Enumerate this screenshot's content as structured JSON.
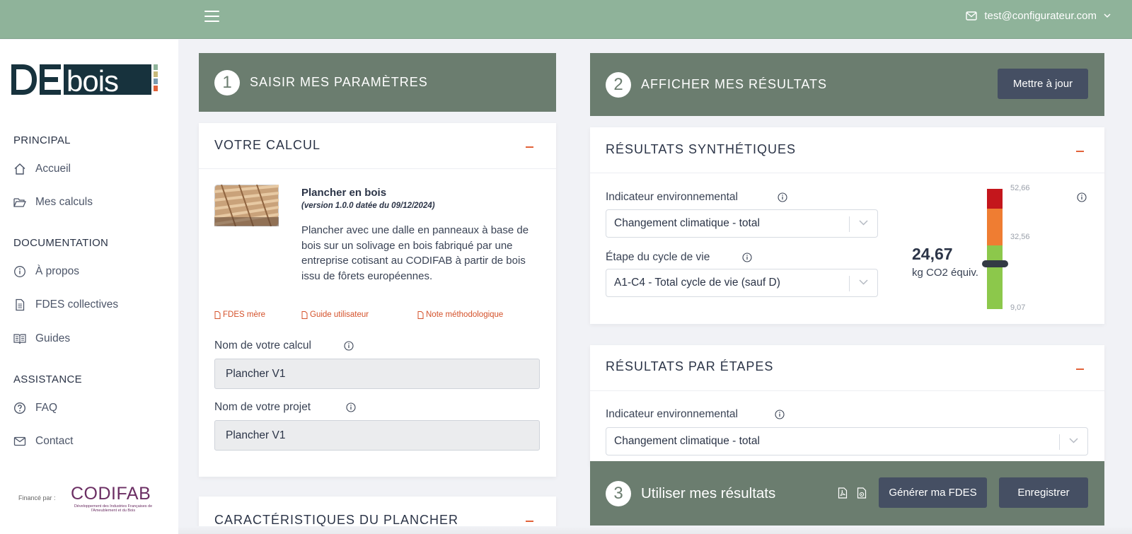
{
  "header": {
    "user_email": "test@configurateur.com"
  },
  "sidebar": {
    "sections": [
      "PRINCIPAL",
      "DOCUMENTATION",
      "ASSISTANCE"
    ],
    "items": [
      {
        "label": "Accueil",
        "icon": "home-icon"
      },
      {
        "label": "Mes calculs",
        "icon": "folder-icon"
      },
      {
        "label": "À propos",
        "icon": "info-icon"
      },
      {
        "label": "FDES collectives",
        "icon": "file-icon"
      },
      {
        "label": "Guides",
        "icon": "book-icon"
      },
      {
        "label": "FAQ",
        "icon": "question-icon"
      },
      {
        "label": "Contact",
        "icon": "mail-icon"
      }
    ],
    "logo_text": "DEbois",
    "funded_by": "Financé par :",
    "partner_logo": "CODIFAB",
    "partner_tagline": "Développement des Industries Françaises de l'Ameublement et du Bois"
  },
  "step1": {
    "number": "1",
    "title": "SAISIR MES PARAMÈTRES",
    "calc_card": {
      "title": "VOTRE CALCUL",
      "product_name": "Plancher en bois",
      "product_version": "(version 1.0.0 datée du 09/12/2024)",
      "product_description": "Plancher avec une dalle en panneaux à base de bois sur un solivage en bois fabriqué par une entreprise cotisant au CODIFAB à partir de bois issu de fôrets européennes.",
      "links": [
        "FDES mère",
        "Guide utilisateur",
        "Note méthodologique"
      ],
      "calc_name_label": "Nom de votre calcul",
      "calc_name_value": "Plancher V1",
      "project_name_label": "Nom de votre projet",
      "project_name_value": "Plancher V1"
    },
    "next_card_title": "CARACTÉRISTIQUES DU PLANCHER"
  },
  "step2": {
    "number": "2",
    "title": "AFFICHER MES RÉSULTATS",
    "update_button": "Mettre à jour",
    "synth": {
      "title": "RÉSULTATS SYNTHÉTIQUES",
      "indicator_label": "Indicateur environnemental",
      "indicator_value": "Changement climatique - total",
      "stage_label": "Étape du cycle de vie",
      "stage_value": "A1-C4 - Total cycle de vie (sauf D)",
      "result_value": "24,67",
      "result_unit": "kg CO2 équiv.",
      "gauge": {
        "max": "52,66",
        "mid": "32,56",
        "min": "9,07",
        "colors": {
          "red": "#c4161c",
          "orange": "#ef7d32",
          "green": "#8cc84b"
        }
      }
    },
    "by_stage": {
      "title": "RÉSULTATS PAR ÉTAPES",
      "indicator_label": "Indicateur environnemental",
      "indicator_value": "Changement climatique - total"
    }
  },
  "step3": {
    "number": "3",
    "title": "Utiliser mes résultats",
    "generate_button": "Générer ma FDES",
    "save_button": "Enregistrer"
  }
}
